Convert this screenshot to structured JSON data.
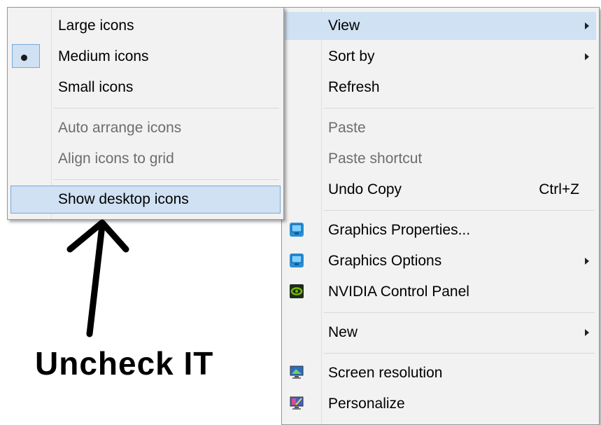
{
  "submenu": {
    "items": [
      {
        "label": "Large icons"
      },
      {
        "label": "Medium icons"
      },
      {
        "label": "Small icons"
      },
      {
        "label": "Auto arrange icons"
      },
      {
        "label": "Align icons to grid"
      },
      {
        "label": "Show desktop icons"
      }
    ]
  },
  "context_menu": {
    "view": "View",
    "sort_by": "Sort by",
    "refresh": "Refresh",
    "paste": "Paste",
    "paste_shortcut": "Paste shortcut",
    "undo_copy": "Undo Copy",
    "undo_shortcut": "Ctrl+Z",
    "graphics_properties": "Graphics Properties...",
    "graphics_options": "Graphics Options",
    "nvidia": "NVIDIA Control Panel",
    "new": "New",
    "screen_resolution": "Screen resolution",
    "personalize": "Personalize"
  },
  "annotation": {
    "text": "Uncheck IT"
  },
  "colors": {
    "highlight": "#cfe1f3",
    "highlight_border": "#7aa7d9",
    "menu_bg": "#f2f2f2",
    "disabled_text": "#6d6d6d"
  },
  "icons": {
    "graphics_properties": "intel-graphics-icon",
    "graphics_options": "intel-graphics-icon",
    "nvidia": "nvidia-icon",
    "screen_resolution": "monitor-icon",
    "personalize": "personalize-icon"
  }
}
